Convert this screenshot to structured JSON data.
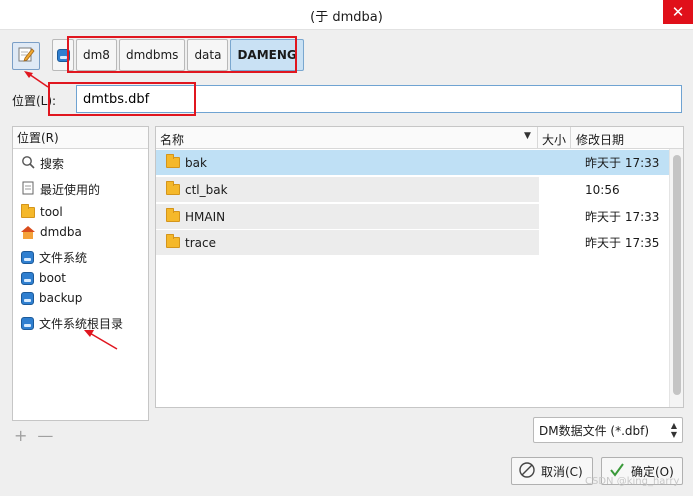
{
  "window": {
    "title": "(于 dmdba)",
    "close_glyph": "✕"
  },
  "path_bar": {
    "edit_toggle_icon": "pencil-icon",
    "crumbs": [
      "dm8",
      "dmdbms",
      "data",
      "DAMENG"
    ],
    "active_crumb": "DAMENG"
  },
  "location": {
    "label": "位置(L):",
    "value": "dmtbs.dbf"
  },
  "places": {
    "header": "位置(R)",
    "items": [
      {
        "label": "搜索",
        "icon": "search-icon"
      },
      {
        "label": "最近使用的",
        "icon": "recent-icon"
      },
      {
        "label": "tool",
        "icon": "folder-icon"
      },
      {
        "label": "dmdba",
        "icon": "home-icon"
      },
      {
        "label": "文件系统",
        "icon": "drive-icon"
      },
      {
        "label": "boot",
        "icon": "drive-icon"
      },
      {
        "label": "backup",
        "icon": "drive-icon"
      },
      {
        "label": "文件系统根目录",
        "icon": "drive-icon"
      }
    ],
    "add_glyph": "+",
    "remove_glyph": "—"
  },
  "files": {
    "columns": {
      "name": "名称",
      "size": "大小",
      "modified": "修改日期"
    },
    "rows": [
      {
        "name": "bak",
        "modified": "昨天于 17:33",
        "selected": true
      },
      {
        "name": "ctl_bak",
        "modified": "10:56",
        "selected": false
      },
      {
        "name": "HMAIN",
        "modified": "昨天于 17:33",
        "selected": false
      },
      {
        "name": "trace",
        "modified": "昨天于 17:35",
        "selected": false
      }
    ]
  },
  "filter": {
    "value": "DM数据文件 (*.dbf)"
  },
  "buttons": {
    "cancel": "取消(C)",
    "ok": "确定(O)"
  },
  "watermark": "CSDN @king_harry",
  "colors": {
    "selection": "#bfe0f5",
    "annotation": "#e0161f",
    "close": "#e0101a"
  }
}
